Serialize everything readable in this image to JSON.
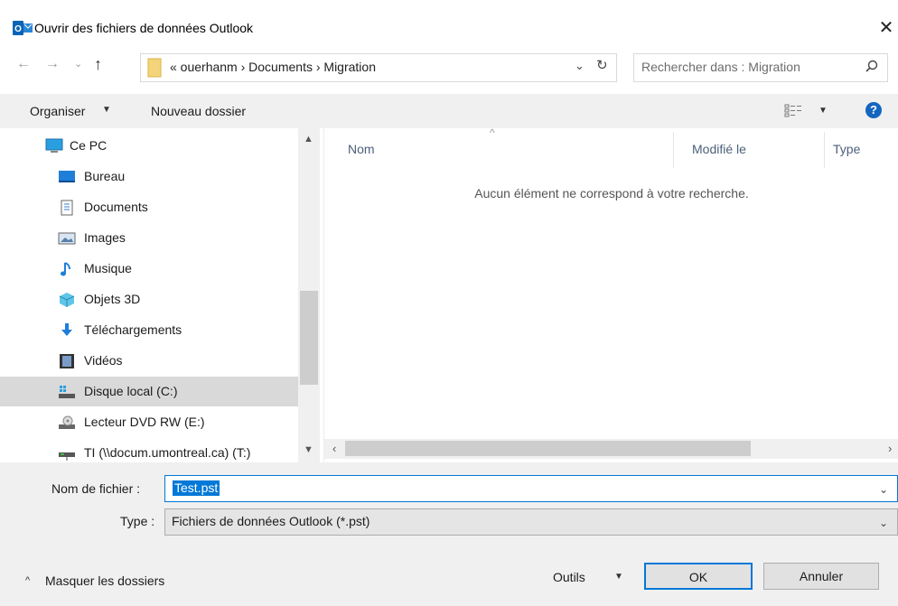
{
  "window": {
    "title": "Ouvrir des fichiers de données Outlook",
    "close_glyph": "✕"
  },
  "nav": {
    "back_glyph": "←",
    "forward_glyph": "→",
    "recent_glyph": "⌄",
    "up_glyph": "↑",
    "path": "« ouerhanm  ›  Documents  ›  Migration",
    "dropdown_glyph": "⌄",
    "refresh_glyph": "↻",
    "search_placeholder": "Rechercher dans : Migration"
  },
  "toolbar": {
    "organize_label": "Organiser",
    "new_folder_label": "Nouveau dossier",
    "help_glyph": "?"
  },
  "sidebar": {
    "items": [
      {
        "label": "Ce PC",
        "icon": "computer-icon"
      },
      {
        "label": "Bureau",
        "icon": "desktop-icon"
      },
      {
        "label": "Documents",
        "icon": "documents-icon"
      },
      {
        "label": "Images",
        "icon": "images-icon"
      },
      {
        "label": "Musique",
        "icon": "music-icon"
      },
      {
        "label": "Objets 3D",
        "icon": "objects-3d-icon"
      },
      {
        "label": "Téléchargements",
        "icon": "downloads-icon"
      },
      {
        "label": "Vidéos",
        "icon": "videos-icon"
      },
      {
        "label": "Disque local (C:)",
        "icon": "local-disk-icon",
        "selected": true
      },
      {
        "label": "Lecteur DVD RW (E:)",
        "icon": "dvd-drive-icon"
      },
      {
        "label": "TI (\\\\docum.umontreal.ca) (T:)",
        "icon": "network-drive-icon"
      }
    ]
  },
  "content": {
    "columns": [
      "Nom",
      "Modifié le",
      "Type"
    ],
    "empty_message": "Aucun élément ne correspond à votre recherche."
  },
  "footer": {
    "filename_label": "Nom de fichier :",
    "filename_value": "Test.pst",
    "type_label": "Type :",
    "type_value": "Fichiers de données Outlook (*.pst)",
    "hide_folders_label": "Masquer les dossiers",
    "tools_label": "Outils",
    "ok_label": "OK",
    "cancel_label": "Annuler"
  },
  "colors": {
    "accent": "#0078d7",
    "selection_bg": "#d9d9d9",
    "toolbar_bg": "#f0f0f0",
    "outlook_blue": "#0a64b5"
  }
}
